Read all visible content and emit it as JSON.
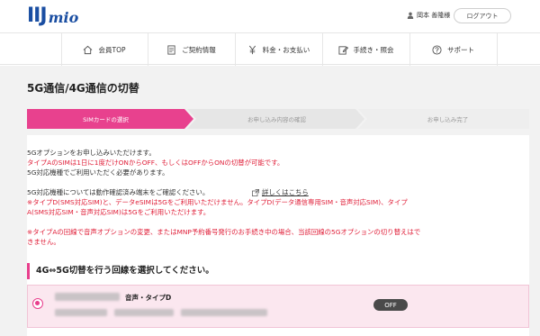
{
  "header": {
    "logo_main": "IIJ",
    "logo_sub": "mio",
    "user_name": "岡本 善隆様",
    "logout_label": "ログアウト"
  },
  "nav": {
    "items": [
      {
        "label": "会員TOP",
        "icon": "home-icon"
      },
      {
        "label": "ご契約情報",
        "icon": "document-icon"
      },
      {
        "label": "料金・お支払い",
        "icon": "yen-icon"
      },
      {
        "label": "手続き・照会",
        "icon": "pencil-icon"
      },
      {
        "label": "サポート",
        "icon": "question-icon"
      }
    ]
  },
  "page": {
    "title": "5G通信/4G通信の切替"
  },
  "steps": [
    {
      "label": "SIMカードの選択",
      "active": true
    },
    {
      "label": "お申し込み内容の確認",
      "active": false
    },
    {
      "label": "お申し込み完了",
      "active": false
    }
  ],
  "notice": {
    "line1": "5Gオプションをお申し込みいただけます。",
    "line2": "タイプAのSIMは1日に1度だけONからOFF、もしくはOFFからONの切替が可能です。",
    "line3": "5G対応機種でご利用いただく必要があります。",
    "line4": "5G対応機種については動作確認済み端末をご確認ください。",
    "details_link": "詳しくはこちら",
    "line5": "※タイプD(SMS対応SIM)と、データeSIMは5Gをご利用いただけません。タイプD(データ通信専用SIM・音声対応SIM)、タイプ",
    "line6": "A(SMS対応SIM・音声対応SIM)は5Gをご利用いただけます。",
    "line7": "※タイプAの回線で音声オプションの変更、またはMNP予約番号発行のお手続き中の場合、当該回線の5Gオプションの切り替えはで",
    "line8": "きません。"
  },
  "section": {
    "heading": "4G⇔5G切替を行う回線を選択してください。"
  },
  "line_option": {
    "type_label": "音声・タイプD",
    "toggle_label": "OFF",
    "selected": true
  },
  "colors": {
    "accent_pink": "#e83e8c",
    "alert_red": "#e0203a",
    "logo_blue": "#1a4ea2"
  }
}
